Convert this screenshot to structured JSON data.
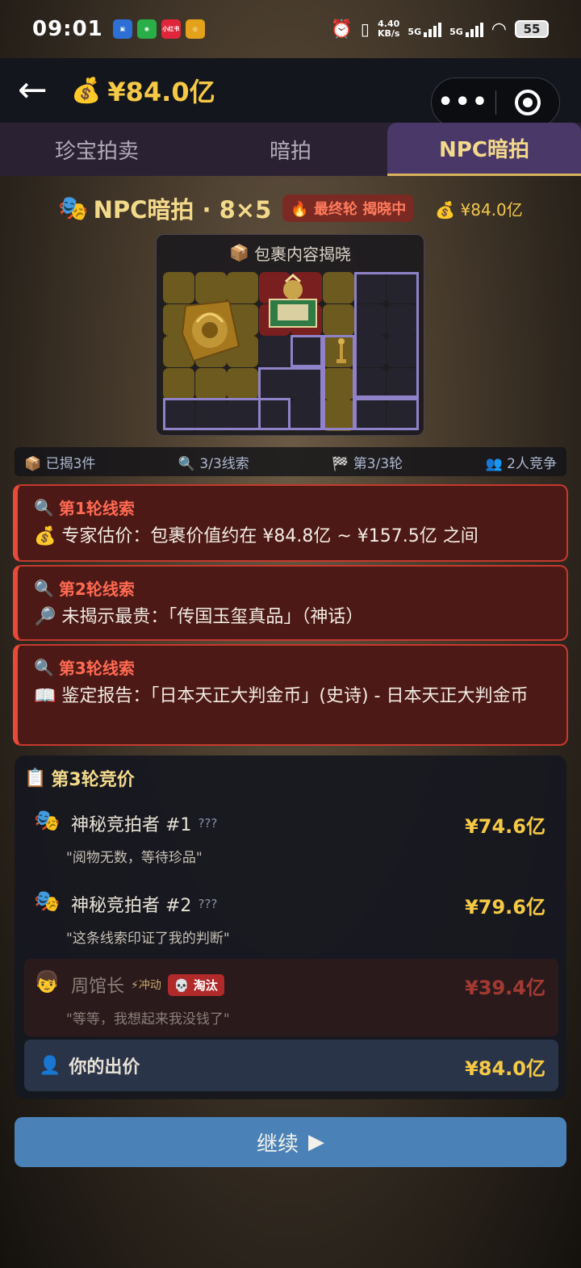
{
  "status_bar": {
    "time": "09:01",
    "net_speed_top": "4.40",
    "net_speed_bottom": "KB/s",
    "signal1": "5G",
    "signal2": "5G",
    "battery": "55",
    "apps": [
      "app-icon",
      "wechat-icon",
      "xiaohongshu-icon",
      "weibo-icon",
      "game-icon"
    ],
    "xhs_label": "小红书"
  },
  "header": {
    "back_icon": "←",
    "balance": "¥84.0亿",
    "more_icon": "•••"
  },
  "tabs": [
    {
      "label": "珍宝拍卖",
      "active": false
    },
    {
      "label": "暗拍",
      "active": false
    },
    {
      "label": "NPC暗拍",
      "active": true
    }
  ],
  "title_row": {
    "title": "NPC暗拍 · 8×5",
    "badge": "🔥 最终轮 揭晓中",
    "balance": "💰 ¥84.0亿"
  },
  "package": {
    "title": "包裹内容揭晓"
  },
  "stats": {
    "revealed": "已揭3件",
    "clues": "3/3线索",
    "round": "第3/3轮",
    "competitors": "2人竞争"
  },
  "clues": [
    {
      "head": "第1轮线索",
      "text": "💰 专家估价：包裹价值约在 ¥84.8亿 ~ ¥157.5亿 之间"
    },
    {
      "head": "第2轮线索",
      "text": "🔎 未揭示最贵：「传国玉玺真品」（神话）"
    },
    {
      "head": "第3轮线索",
      "text": "📖 鉴定报告：「日本天正大判金币」(史诗) - 日本天正大判金币"
    }
  ],
  "bidding": {
    "title": "第3轮竞价",
    "bidders": [
      {
        "icon": "🎭",
        "name": "神秘竞拍者 #1",
        "tag": "???",
        "quote": "\"阅物无数，等待珍品\"",
        "price": "¥74.6亿"
      },
      {
        "icon": "🎭",
        "name": "神秘竞拍者 #2",
        "tag": "???",
        "quote": "\"这条线索印证了我的判断\"",
        "price": "¥79.6亿"
      },
      {
        "icon": "👦",
        "name": "周馆长",
        "tag": "⚡冲动",
        "badge": "💀 淘汰",
        "quote": "\"等等，我想起来我没钱了\"",
        "price": "¥39.4亿"
      }
    ],
    "my_bid_label": "你的出价",
    "my_bid_price": "¥84.0亿"
  },
  "continue_button": {
    "label": "继续",
    "arrow": "▶"
  }
}
